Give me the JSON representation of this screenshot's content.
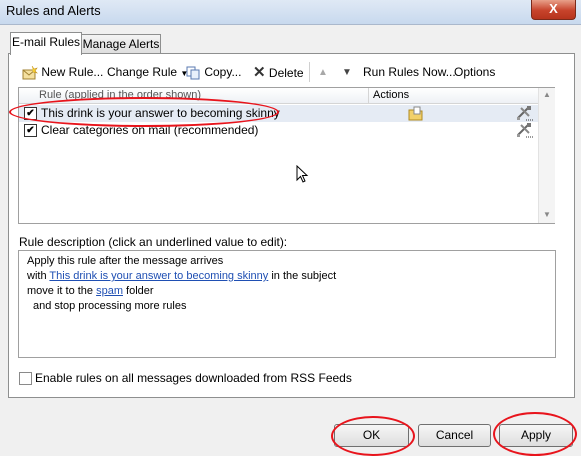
{
  "window": {
    "title": "Rules and Alerts",
    "close_glyph": "X"
  },
  "tabs": [
    {
      "label": "E-mail Rules",
      "active": true
    },
    {
      "label": "Manage Alerts",
      "active": false
    }
  ],
  "toolbar": {
    "new_rule": "New Rule...",
    "change_rule": "Change Rule",
    "copy": "Copy...",
    "delete": "Delete",
    "run_rules_now": "Run Rules Now...",
    "options": "Options"
  },
  "rules_list": {
    "columns": {
      "rule": "Rule (applied in the order shown)",
      "actions": "Actions"
    },
    "rows": [
      {
        "name": "This drink is your answer to becoming skinny",
        "checked": true,
        "selected": true
      },
      {
        "name": "Clear categories on mail (recommended)",
        "checked": true,
        "selected": false
      }
    ]
  },
  "description": {
    "label": "Rule description (click an underlined value to edit):",
    "line1": "Apply this rule after the message arrives",
    "line2_prefix": "with ",
    "line2_link": "This drink is your answer to becoming skinny",
    "line2_suffix": " in the subject",
    "line3_prefix": "move it to the ",
    "line3_link": "spam",
    "line3_suffix": " folder",
    "line4": "and stop processing more rules"
  },
  "rss": {
    "label": "Enable rules on all messages downloaded from RSS Feeds",
    "checked": false
  },
  "buttons": {
    "ok": "OK",
    "cancel": "Cancel",
    "apply": "Apply"
  },
  "colors": {
    "annotation": "#e8141c",
    "link": "#1f4fb3",
    "selected_row": "#e5ebf4"
  }
}
